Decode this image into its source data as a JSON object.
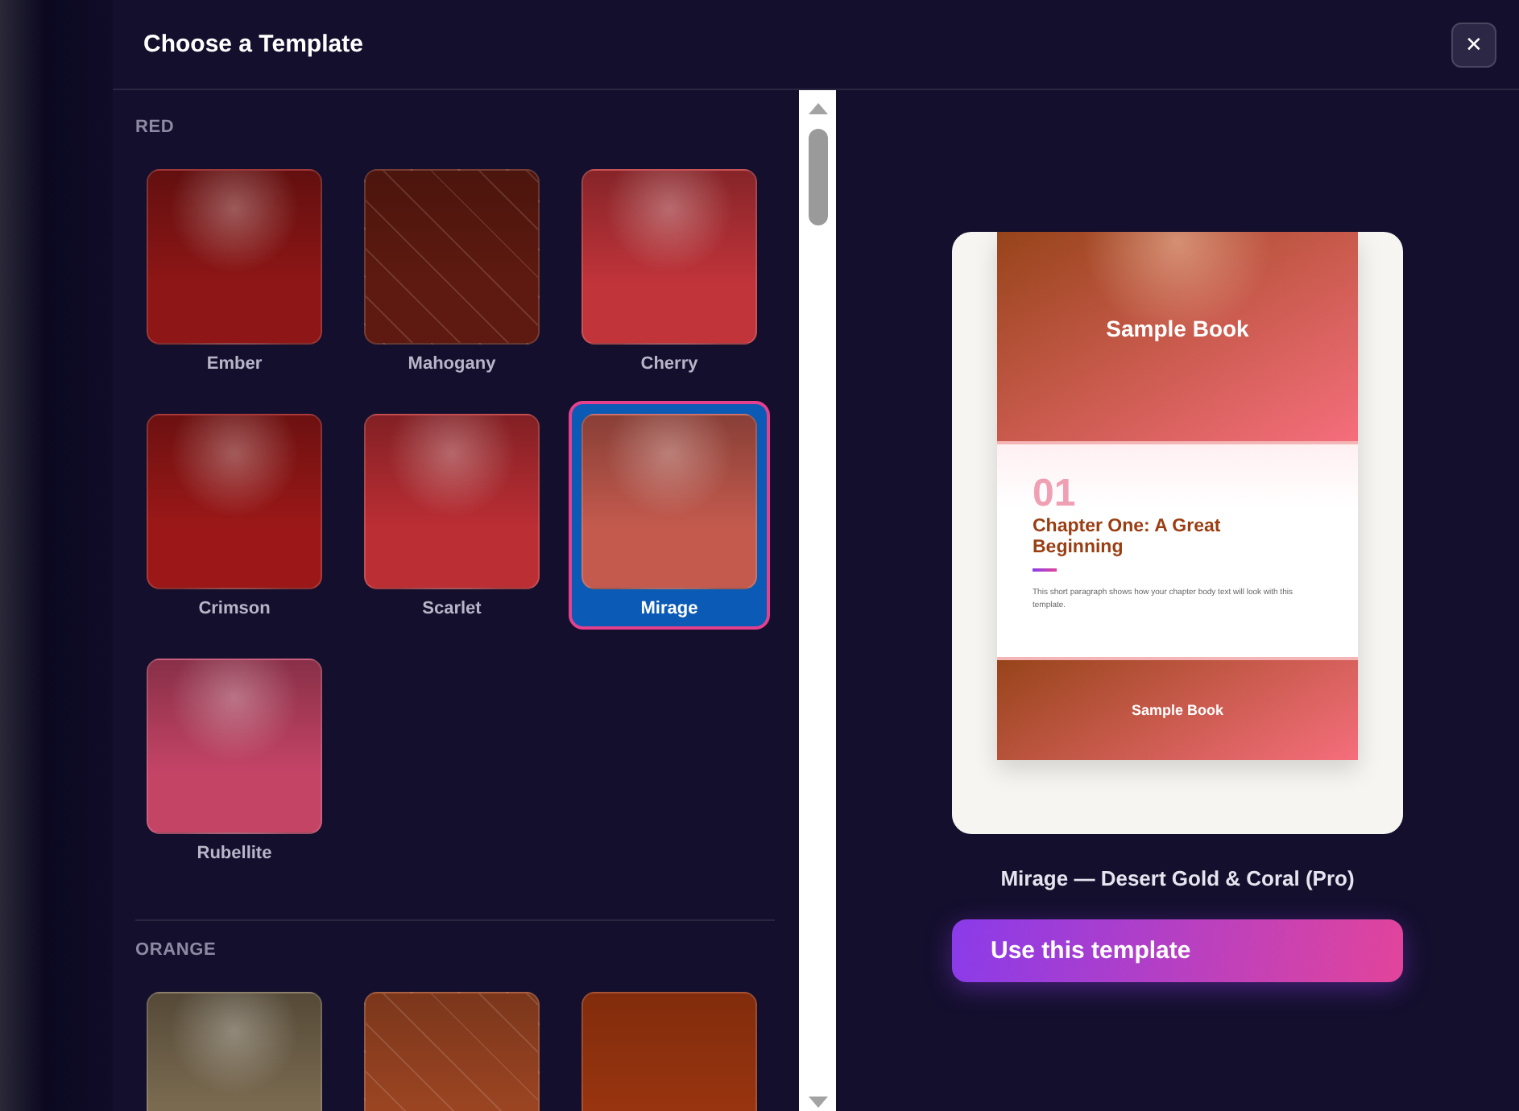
{
  "dialog": {
    "title": "Choose a Template",
    "close_label": "✕"
  },
  "groups": [
    {
      "heading": "RED",
      "templates": [
        {
          "name": "Ember",
          "kind": "glow",
          "color": "#8e1616",
          "selected": false
        },
        {
          "name": "Mahogany",
          "kind": "stripes",
          "color": "#5e1a10",
          "selected": false
        },
        {
          "name": "Cherry",
          "kind": "glow",
          "color": "#c0343a",
          "selected": false
        },
        {
          "name": "Crimson",
          "kind": "glow",
          "color": "#9c1818",
          "selected": false
        },
        {
          "name": "Scarlet",
          "kind": "glow",
          "color": "#bb2e34",
          "selected": false
        },
        {
          "name": "Mirage",
          "kind": "glow",
          "color": "#c45a4e",
          "selected": true
        },
        {
          "name": "Rubellite",
          "kind": "glow",
          "color": "#c44466",
          "selected": false
        }
      ]
    },
    {
      "heading": "ORANGE",
      "templates": [
        {
          "kind": "glow",
          "color": "#7a6a50",
          "selected": false
        },
        {
          "kind": "stripes",
          "color": "#9a4422",
          "selected": false
        },
        {
          "kind": "plain",
          "color": "#98340f",
          "selected": false
        }
      ]
    }
  ],
  "preview": {
    "cover_title": "Sample Book",
    "chapter_number": "01",
    "chapter_title": "Chapter One: A Great Beginning",
    "body": "This short paragraph shows how your chapter body text will look with this template.",
    "footer_title": "Sample Book"
  },
  "caption": "Mirage — Desert Gold & Coral (Pro)",
  "primary_button": "Use this template"
}
